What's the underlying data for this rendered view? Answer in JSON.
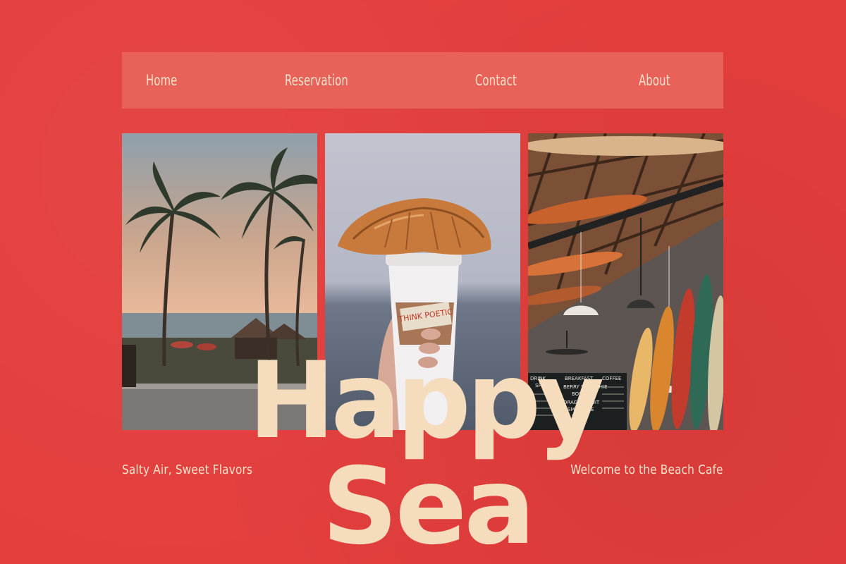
{
  "nav": {
    "items": [
      {
        "label": "Home"
      },
      {
        "label": "Reservation"
      },
      {
        "label": "Contact"
      },
      {
        "label": "About"
      }
    ]
  },
  "hero": {
    "brand_line1": "Happy",
    "brand_line2": "Sea",
    "tagline_left": "Salty Air, Sweet Flavors",
    "tagline_right": "Welcome to the Beach Cafe"
  },
  "photos": {
    "cup_note": "THINK POETIC",
    "menu_board": {
      "title_left": "DRINK",
      "title_mid": "BREAKFAST",
      "title_right": "COFFEE",
      "lines": [
        "SPECIALS",
        "BERRY SMOOTHIE",
        "BOWL",
        "DRAGONFRUIT",
        "SMOOTHIE",
        "BOWL"
      ]
    }
  },
  "colors": {
    "background": "#e33e3c",
    "nav_bar": "#e9625a",
    "text_cream": "#f6e4cc"
  }
}
